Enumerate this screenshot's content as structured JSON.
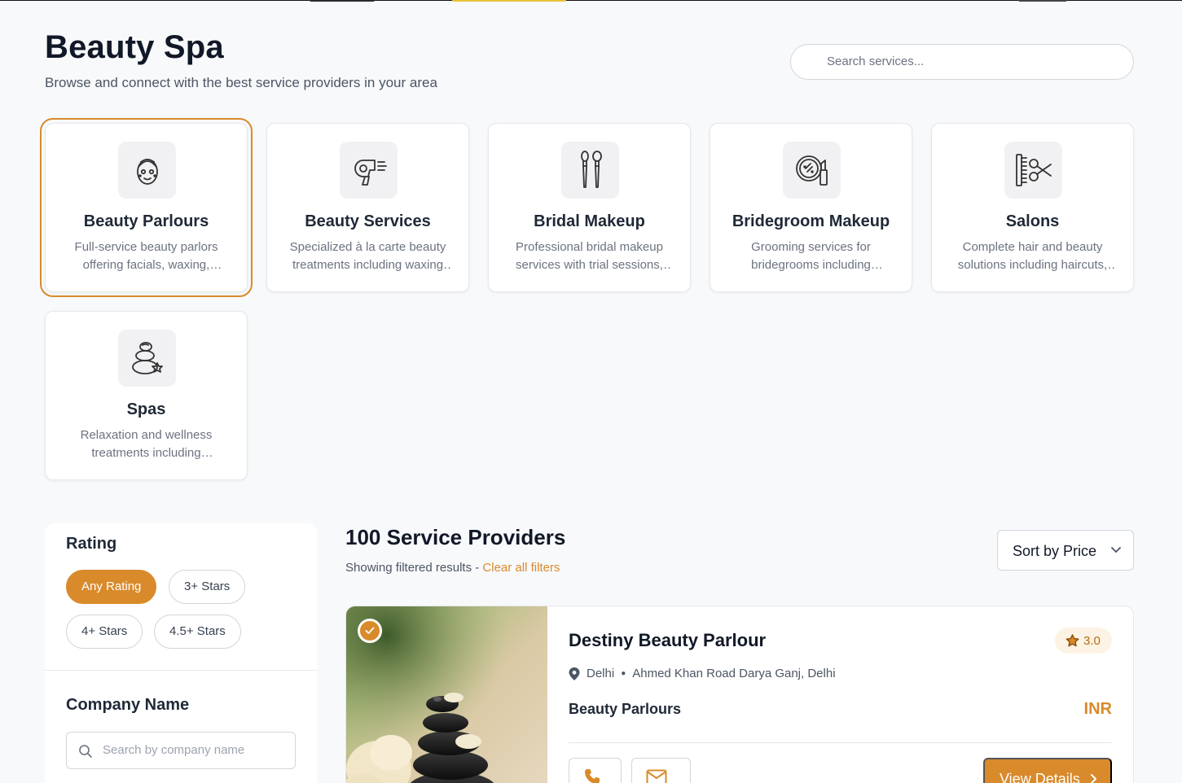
{
  "header": {
    "title": "Beauty Spa",
    "subtitle": "Browse and connect with the best service providers in your area"
  },
  "search": {
    "placeholder": "Search services..."
  },
  "categories": [
    {
      "title": "Beauty Parlours",
      "desc": "Full-service beauty parlors offering facials, waxing, threading and more",
      "icon": "face-mask-icon",
      "selected": true
    },
    {
      "title": "Beauty Services",
      "desc": "Specialized à la carte beauty treatments including waxing and more",
      "icon": "hair-dryer-icon"
    },
    {
      "title": "Bridal Makeup",
      "desc": "Professional bridal makeup services with trial sessions, styling and more",
      "icon": "makeup-brushes-icon"
    },
    {
      "title": "Bridegroom Makeup",
      "desc": "Grooming services for bridegrooms including skincare and more",
      "icon": "mirror-lipstick-icon"
    },
    {
      "title": "Salons",
      "desc": "Complete hair and beauty solutions including haircuts, styling and more",
      "icon": "comb-scissors-icon"
    },
    {
      "title": "Spas",
      "desc": "Relaxation and wellness treatments including massages and more",
      "icon": "spa-stones-icon"
    }
  ],
  "filters": {
    "rating_heading": "Rating",
    "rating_options": [
      "Any Rating",
      "3+ Stars",
      "4+ Stars",
      "4.5+ Stars"
    ],
    "rating_active": "Any Rating",
    "company_heading": "Company Name",
    "company_placeholder": "Search by company name"
  },
  "results": {
    "count_label": "100 Service Providers",
    "showing_label": "Showing filtered results - ",
    "clear_label": "Clear all filters",
    "sort_label": "Sort by Price"
  },
  "provider": {
    "name": "Destiny Beauty Parlour",
    "rating": "3.0",
    "city": "Delhi",
    "address": "Ahmed Khan Road Darya Ganj, Delhi",
    "category": "Beauty Parlours",
    "currency": "INR",
    "view_label": "View Details"
  },
  "colors": {
    "accent": "#d98a2b",
    "text": "#111827",
    "muted": "#6b7280"
  }
}
